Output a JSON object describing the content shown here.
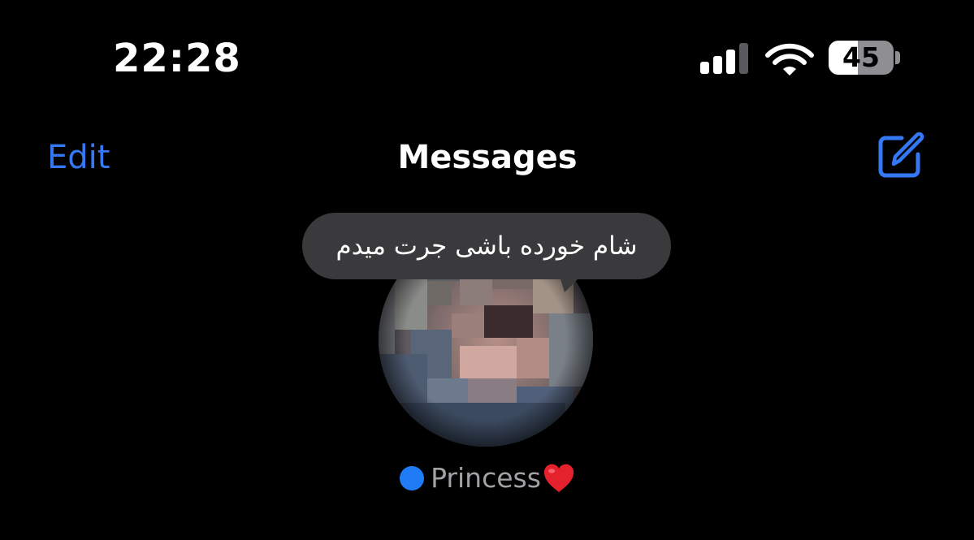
{
  "status_bar": {
    "time": "22:28",
    "battery_percent": "45",
    "battery_level": 0.45,
    "signal_bars_active": 3,
    "signal_bars_total": 4,
    "signal_icon": "cellular-signal-icon",
    "wifi_icon": "wifi-icon",
    "battery_icon": "battery-icon"
  },
  "nav": {
    "edit_label": "Edit",
    "title": "Messages",
    "compose_icon": "compose-icon"
  },
  "pinned": [
    {
      "name": "Princess",
      "emoji": "❤️",
      "emoji_icon": "red-heart-icon",
      "unread": true,
      "preview": "شام خورده باشی جرت میدم",
      "avatar_icon": "blurred-avatar-photo"
    }
  ],
  "colors": {
    "background": "#000000",
    "accent_blue": "#3478f6",
    "unread_dot": "#1f7cf6",
    "bubble": "#3a3a3c",
    "secondary_text": "#a1a1a6",
    "heart_red": "#e5212d",
    "battery_fill": "#ffffff",
    "battery_empty": "#8e8e93"
  }
}
